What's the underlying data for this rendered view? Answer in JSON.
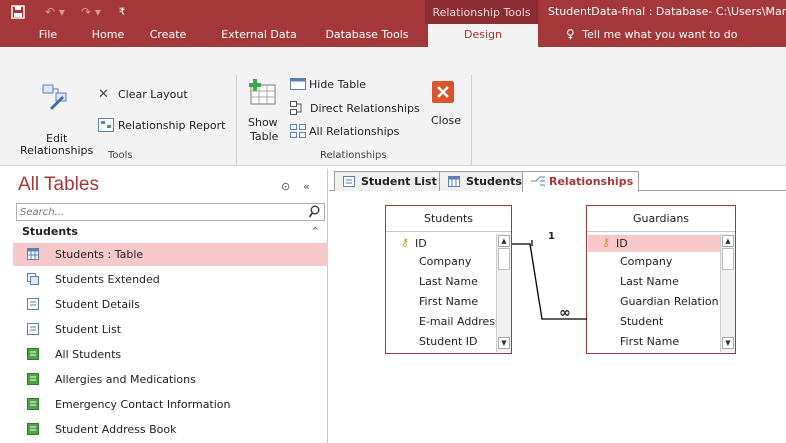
{
  "titlebar": {
    "context_tab": "Relationship Tools",
    "title": "StudentData-final : Database- C:\\Users\\Mar"
  },
  "tabs": {
    "items": [
      "File",
      "Home",
      "Create",
      "External Data",
      "Database Tools",
      "Design"
    ],
    "active": "Design",
    "tell_me": "Tell me what you want to do"
  },
  "ribbon": {
    "tools": {
      "edit_relationships_line1": "Edit",
      "edit_relationships_line2": "Relationships",
      "clear_layout": "Clear Layout",
      "relationship_report": "Relationship Report",
      "group_label": "Tools"
    },
    "relationships": {
      "show_table_line1": "Show",
      "show_table_line2": "Table",
      "hide_table": "Hide Table",
      "direct_relationships": "Direct Relationships",
      "all_relationships": "All Relationships",
      "close": "Close",
      "group_label": "Relationships"
    }
  },
  "nav": {
    "title": "All Tables",
    "search_placeholder": "Search...",
    "section": "Students",
    "items": [
      {
        "label": "Students : Table",
        "icon": "table-icon",
        "selected": true
      },
      {
        "label": "Students Extended",
        "icon": "query-icon"
      },
      {
        "label": "Student Details",
        "icon": "form-icon"
      },
      {
        "label": "Student List",
        "icon": "form-icon"
      },
      {
        "label": "All Students",
        "icon": "report-icon"
      },
      {
        "label": "Allergies and Medications",
        "icon": "report-icon"
      },
      {
        "label": "Emergency Contact Information",
        "icon": "report-icon"
      },
      {
        "label": "Student Address Book",
        "icon": "report-icon"
      }
    ]
  },
  "doctabs": [
    "Student List",
    "Students",
    "Relationships"
  ],
  "active_doctab": "Relationships",
  "tables": {
    "students": {
      "title": "Students",
      "fields": [
        "ID",
        "Company",
        "Last Name",
        "First Name",
        "E-mail Address",
        "Student ID"
      ]
    },
    "guardians": {
      "title": "Guardians",
      "fields": [
        "ID",
        "Company",
        "Last Name",
        "Guardian Relation",
        "Student",
        "First Name"
      ]
    }
  },
  "relationship": {
    "one_label": "1",
    "many_label": "∞"
  },
  "colors": {
    "accent": "#a4373a",
    "ribbon_bg": "#f3f3f3",
    "selected_item": "#f6c8ca"
  }
}
